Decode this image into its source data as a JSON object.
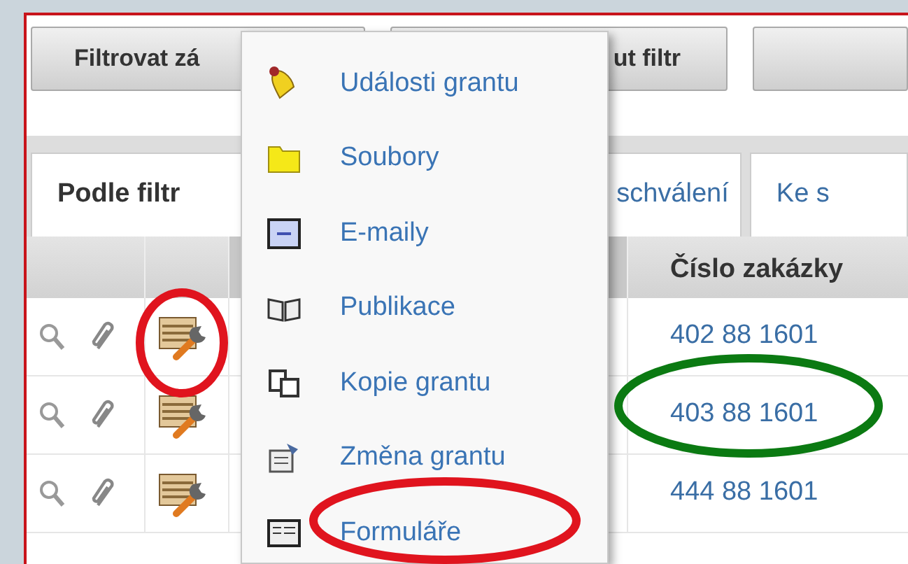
{
  "toolbar": {
    "buttons": [
      {
        "label": "Filtrovat zá"
      },
      {
        "label": "ut filtr"
      }
    ]
  },
  "tabs": [
    {
      "label": "Podle filtr",
      "selected": true
    },
    {
      "label": "schválení",
      "selected": false
    },
    {
      "label": "Ke s",
      "selected": false
    }
  ],
  "table": {
    "column_4": "Číslo zakázky",
    "rows": [
      {
        "number": "402 88 1601"
      },
      {
        "number": "403 88 1601"
      },
      {
        "number": "444 88 1601"
      }
    ]
  },
  "menu": {
    "items": [
      {
        "label": "Události grantu"
      },
      {
        "label": "Soubory"
      },
      {
        "label": "E-maily"
      },
      {
        "label": "Publikace"
      },
      {
        "label": "Kopie grantu"
      },
      {
        "label": "Změna grantu"
      },
      {
        "label": "Formuláře"
      }
    ]
  },
  "annotations": [
    {
      "color": "#e0141e"
    },
    {
      "color": "#0b7a12"
    },
    {
      "color": "#e0141e"
    }
  ]
}
